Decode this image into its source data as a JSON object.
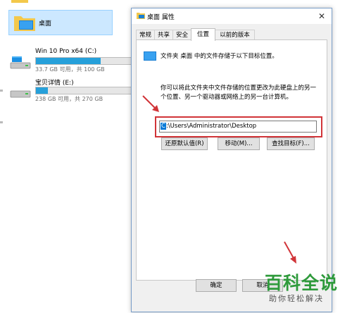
{
  "explorer": {
    "desktop_label": "桌面",
    "drives": [
      {
        "name": "Win 10 Pro x64 (C:)",
        "size_text": "33.7 GB 可用，共 100 GB",
        "used_fraction": 0.66
      },
      {
        "name": "宝贝详情 (E:)",
        "size_text": "238 GB 可用，共 270 GB",
        "used_fraction": 0.12
      }
    ]
  },
  "dialog": {
    "title": "桌面 属性",
    "close_glyph": "✕",
    "tabs": [
      {
        "label": "常规"
      },
      {
        "label": "共享"
      },
      {
        "label": "安全"
      },
      {
        "label": "位置",
        "active": true
      },
      {
        "label": "以前的版本"
      }
    ],
    "location_info": "文件夹 桌面 中的文件存储于以下目标位置。",
    "description": "你可以将此文件夹中文件存储的位置更改为此硬盘上的另一个位置、另一个驱动器或网络上的另一台计算机。",
    "path_first_char": "C",
    "path_rest": ":\\Users\\Administrator\\Desktop",
    "buttons": {
      "restore_default": "还原默认值(R)",
      "move": "移动(M)...",
      "find_target": "查找目标(F)...",
      "ok": "确定",
      "cancel": "取消"
    }
  },
  "watermark": {
    "title": "百科全说",
    "subtitle": "助你轻松解决"
  },
  "colors": {
    "accent": "#0078d7",
    "highlight_red": "#d13438",
    "drive_fill": "#26a0da",
    "watermark_green": "#2e9a3b"
  }
}
